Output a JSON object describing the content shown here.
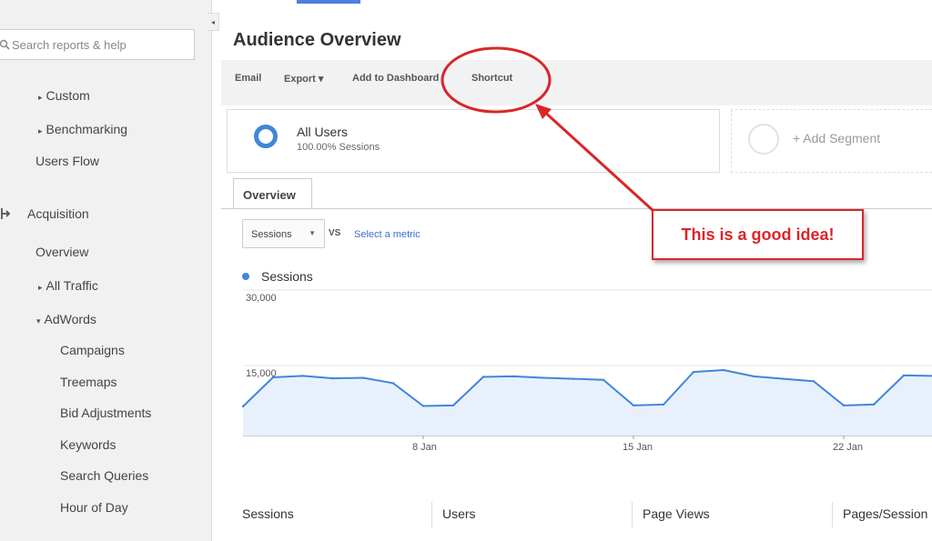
{
  "search": {
    "placeholder": "Search reports & help"
  },
  "sidebar": {
    "items": [
      {
        "label": "Custom",
        "expander": "▸"
      },
      {
        "label": "Benchmarking",
        "expander": "▸"
      },
      {
        "label": "Users Flow"
      },
      {
        "label": "Acquisition",
        "icon": "acquisition-icon"
      },
      {
        "label": "Overview"
      },
      {
        "label": "All Traffic",
        "expander": "▸"
      },
      {
        "label": "AdWords",
        "expander": "▾"
      },
      {
        "label": "Campaigns"
      },
      {
        "label": "Treemaps"
      },
      {
        "label": "Bid Adjustments"
      },
      {
        "label": "Keywords"
      },
      {
        "label": "Search Queries"
      },
      {
        "label": "Hour of Day"
      }
    ]
  },
  "main": {
    "title": "Audience Overview",
    "toolbar": {
      "email": "Email",
      "export": "Export ▾",
      "add_to_dashboard": "Add to Dashboard",
      "shortcut": "Shortcut"
    },
    "segment": {
      "name": "All Users",
      "sub": "100.00% Sessions"
    },
    "add_segment": "+ Add Segment",
    "tab": "Overview",
    "metric_select": "Sessions",
    "vs": "VS",
    "select_metric": "Select a metric",
    "legend": "Sessions",
    "stats": [
      "Sessions",
      "Users",
      "Page Views",
      "Pages/Session"
    ]
  },
  "annotation": {
    "text": "This is a good idea!"
  },
  "colors": {
    "accent": "#3f87d9",
    "annotation": "#d9262b",
    "link": "#3b6fd4"
  },
  "chart_data": {
    "type": "area",
    "series": [
      {
        "name": "Sessions",
        "x": [
          "2 Jan",
          "3 Jan",
          "4 Jan",
          "5 Jan",
          "6 Jan",
          "7 Jan",
          "8 Jan",
          "9 Jan",
          "10 Jan",
          "11 Jan",
          "12 Jan",
          "13 Jan",
          "14 Jan",
          "15 Jan",
          "16 Jan",
          "17 Jan",
          "18 Jan",
          "19 Jan",
          "20 Jan",
          "21 Jan",
          "22 Jan",
          "23 Jan",
          "24 Jan",
          "25 Jan",
          "26 Jan"
        ],
        "values": [
          6000,
          12000,
          12300,
          11800,
          11900,
          10800,
          6100,
          6200,
          12100,
          12200,
          11900,
          11700,
          11500,
          6200,
          6400,
          13100,
          13500,
          12200,
          11700,
          11200,
          6200,
          6400,
          12400,
          12300,
          12000
        ]
      }
    ],
    "ylim": [
      0,
      30000
    ],
    "yticks": [
      "30,000",
      "15,000"
    ],
    "xticks": [
      "8 Jan",
      "15 Jan",
      "22 Jan"
    ],
    "legend": "top-left",
    "grid": true
  }
}
